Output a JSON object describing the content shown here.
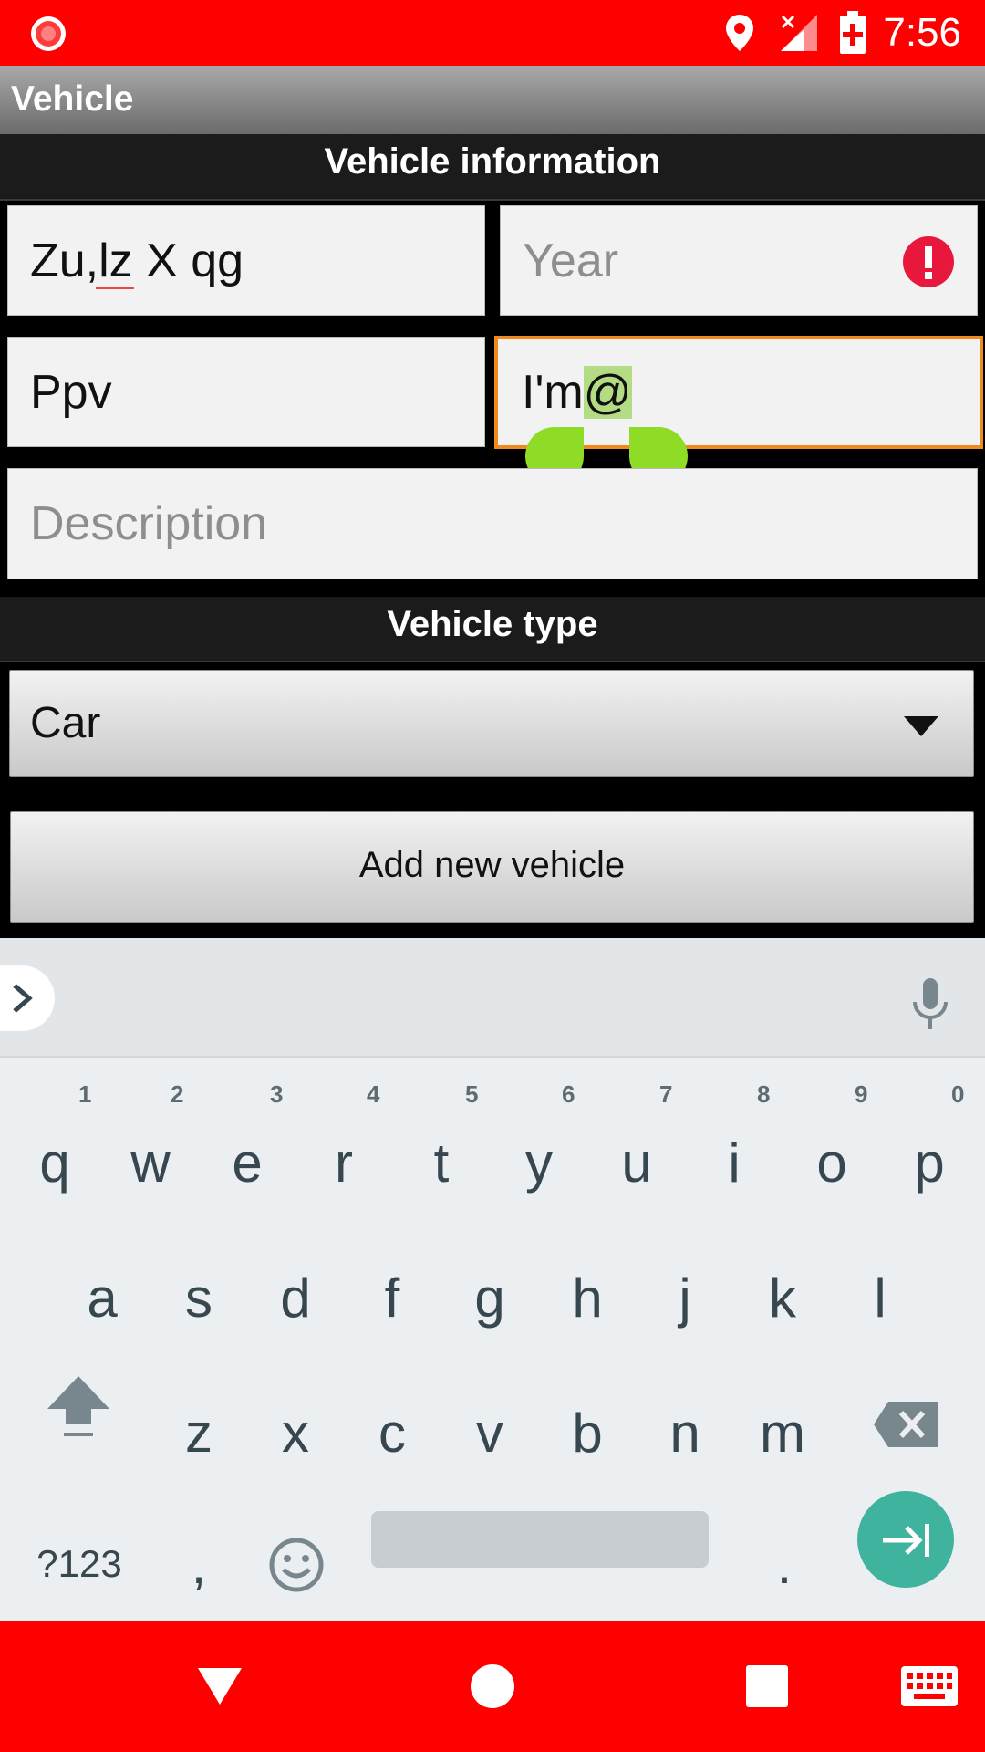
{
  "status_bar": {
    "time": "7:56",
    "icons": [
      "record-icon",
      "location-icon",
      "no-signal-icon",
      "battery-charging-icon"
    ]
  },
  "app": {
    "title": "Vehicle"
  },
  "vehicle_info": {
    "header": "Vehicle information",
    "make_value": "Zu,lz X qg",
    "year_placeholder": "Year",
    "model_value": "Ppv",
    "color_value_prefix": "I'm",
    "color_value_selected": "@",
    "description_placeholder": "Description"
  },
  "vehicle_type": {
    "header": "Vehicle type",
    "selected": "Car",
    "button_label": "Add new vehicle"
  },
  "keyboard": {
    "row1": [
      "q",
      "w",
      "e",
      "r",
      "t",
      "y",
      "u",
      "i",
      "o",
      "p"
    ],
    "row1_hints": [
      "1",
      "2",
      "3",
      "4",
      "5",
      "6",
      "7",
      "8",
      "9",
      "0"
    ],
    "row2": [
      "a",
      "s",
      "d",
      "f",
      "g",
      "h",
      "j",
      "k",
      "l"
    ],
    "row3": [
      "z",
      "x",
      "c",
      "v",
      "b",
      "n",
      "m"
    ],
    "symbols_label": "?123",
    "comma": ",",
    "period": "."
  },
  "colors": {
    "status_bar": "#ff0000",
    "focus_border": "#f08a1c",
    "error": "#e8173c",
    "selection_handle": "#8fdc26",
    "enter_key": "#3fb39e"
  }
}
